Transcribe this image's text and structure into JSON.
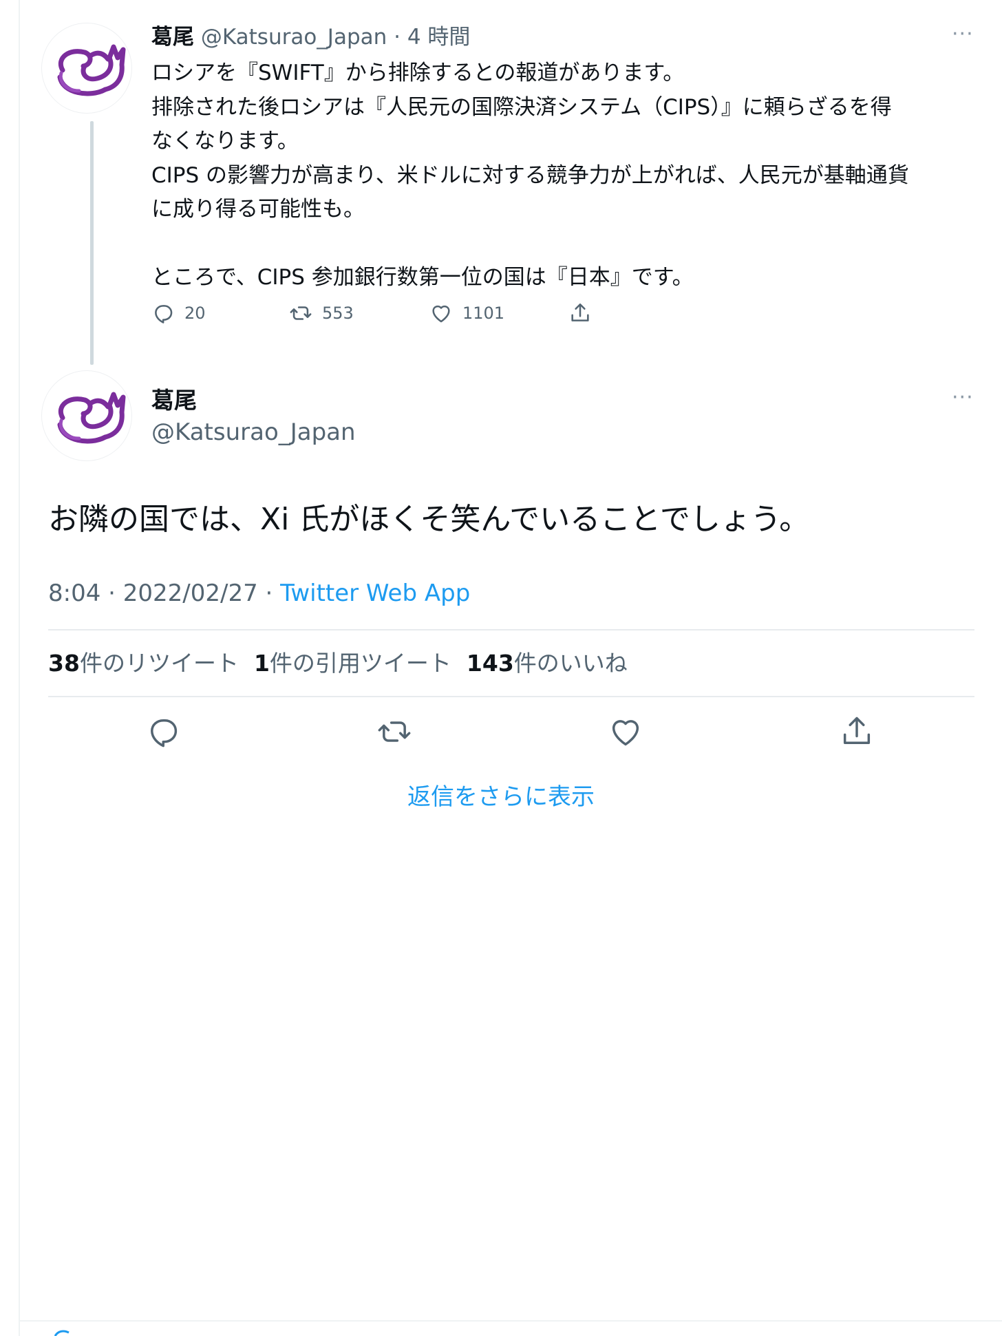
{
  "thread_tweet": {
    "display_name": "葛尾",
    "handle": "@Katsurao_Japan",
    "separator": "·",
    "time": "4 時間",
    "more_label": "···",
    "lines": [
      "ロシアを『SWIFT』から排除するとの報道があります。",
      "排除された後ロシアは『人民元の国際決済システム（CIPS）』に頼らざるを得",
      "なくなります。",
      "CIPS の影響力が高まり、米ドルに対する競争力が上がれば、人民元が基軸通貨",
      "に成り得る可能性も。",
      "",
      "ところで、CIPS 参加銀行数第一位の国は『日本』です。"
    ],
    "reply_count": "20",
    "retweet_count": "553",
    "like_count": "1101"
  },
  "main_tweet": {
    "display_name": "葛尾",
    "handle": "@Katsurao_Japan",
    "more_label": "···",
    "text": "お隣の国では、Xi 氏がほくそ笑んでいることでしょう。",
    "time": "8:04 · 2022/02/27 · ",
    "source": "Twitter Web App",
    "stats": {
      "retweets_count": "38",
      "retweets_label": "件のリツイート",
      "quotes_count": "1",
      "quotes_label": "件の引用ツイート",
      "likes_count": "143",
      "likes_label": "件のいいね"
    }
  },
  "show_more_replies": "返信をさらに表示",
  "colors": {
    "accent": "#1d9bf0",
    "muted": "#536471",
    "text": "#0f1419",
    "avatar_purple": "#7b2d9c"
  },
  "icons": [
    "reply-icon",
    "retweet-icon",
    "like-icon",
    "share-icon",
    "more-icon"
  ]
}
